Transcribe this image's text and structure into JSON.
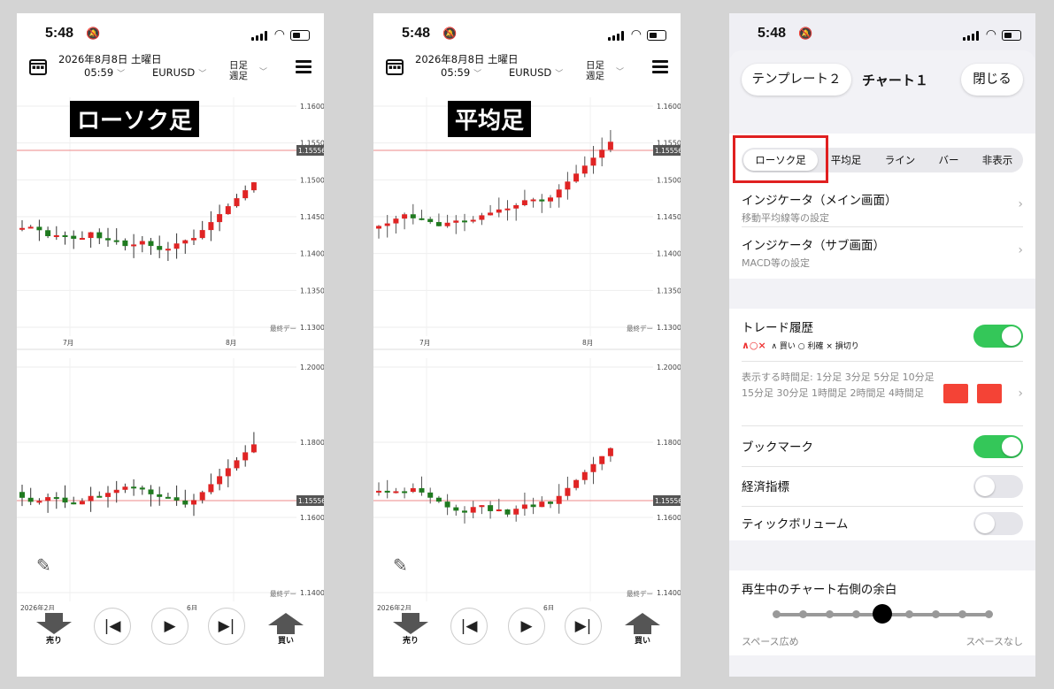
{
  "status": {
    "time": "5:48"
  },
  "header": {
    "date": "2026年8月8日 土曜日",
    "hour": "05:59",
    "pair": "EURUSD",
    "timeframe_line1": "日足",
    "timeframe_line2": "週足"
  },
  "panel1": {
    "label": "ローソク足",
    "top_chart": {
      "y_ticks": [
        "1.1600",
        "1.1550",
        "1.1500",
        "1.1450",
        "1.1400",
        "1.1350",
        "1.1300"
      ],
      "price_tag": "1.15556",
      "x_labels": [
        "7月",
        "8月"
      ],
      "end_label": "最終デー"
    },
    "bottom_chart": {
      "y_ticks": [
        "1.2000",
        "1.1800",
        "1.1600",
        "1.1400"
      ],
      "price_tag": "1.15556",
      "x_labels": [
        "2026年2月",
        "6月"
      ],
      "end_label": "最終デー"
    }
  },
  "panel2": {
    "label": "平均足",
    "top_chart": {
      "y_ticks": [
        "1.1600",
        "1.1550",
        "1.1500",
        "1.1450",
        "1.1400",
        "1.1350",
        "1.1300"
      ],
      "price_tag": "1.15556",
      "x_labels": [
        "7月",
        "8月"
      ],
      "end_label": "最終デー"
    },
    "bottom_chart": {
      "y_ticks": [
        "1.2000",
        "1.1800",
        "1.1600",
        "1.1400"
      ],
      "price_tag": "1.15556",
      "x_labels": [
        "2026年2月",
        "6月"
      ],
      "end_label": "最終デー"
    }
  },
  "controls": {
    "sell": "売り",
    "buy": "買い"
  },
  "settings": {
    "template_btn": "テンプレート２",
    "title": "チャート１",
    "close_btn": "閉じる",
    "chart_types": [
      "ローソク足",
      "平均足",
      "ライン",
      "バー",
      "非表示"
    ],
    "selected_chart_type": "ローソク足",
    "indicator_main": {
      "title": "インジケータ（メイン画面）",
      "sub": "移動平均線等の設定"
    },
    "indicator_sub": {
      "title": "インジケータ（サブ画面）",
      "sub": "MACD等の設定"
    },
    "trade_history": {
      "title": "トレード履歴",
      "legend_icons": "∧○×",
      "legend_text": "∧ 買い ○ 利確 × 損切り",
      "enabled": true
    },
    "timeframes_text": "表示する時間足: 1分足 3分足 5分足 10分足 15分足 30分足 1時間足 2時間足 4時間足",
    "bookmark": {
      "title": "ブックマーク",
      "enabled": true
    },
    "economic": {
      "title": "経済指標",
      "enabled": false
    },
    "tick_volume": {
      "title": "ティックボリューム",
      "enabled": false
    },
    "margin": {
      "title": "再生中のチャート右側の余白",
      "left_label": "スペース広め",
      "right_label": "スペースなし",
      "position": 4,
      "steps": 9
    }
  },
  "colors": {
    "up": "#1f7a1f",
    "down": "#e02424",
    "toggle_on": "#34c759",
    "swatch": "#f44336"
  }
}
